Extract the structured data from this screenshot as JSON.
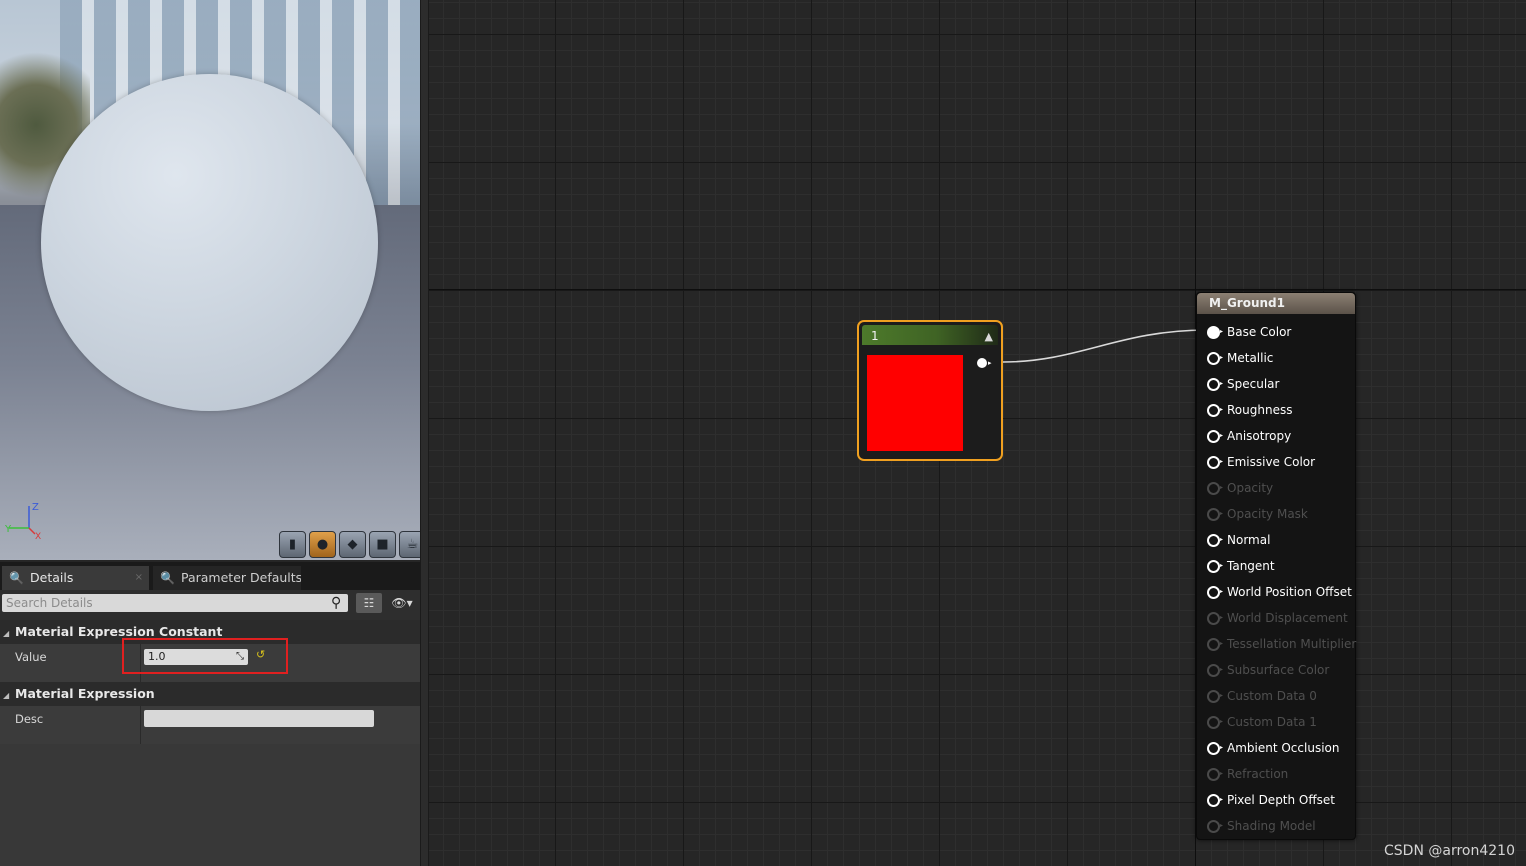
{
  "viewport": {
    "axis_labels": {
      "z": "Z",
      "y": "Y",
      "x": "X"
    },
    "preview_buttons": [
      {
        "icon": "cylinder-icon",
        "glyph": "▮"
      },
      {
        "icon": "sphere-icon",
        "glyph": "●"
      },
      {
        "icon": "plane-icon",
        "glyph": "◆"
      },
      {
        "icon": "cube-icon",
        "glyph": "■"
      },
      {
        "icon": "teapot-icon",
        "glyph": "☕"
      }
    ],
    "active_button": 1
  },
  "details": {
    "tabs": [
      {
        "label": "Details",
        "icon": "details-magnifier-icon",
        "glyph": "🔍"
      },
      {
        "label": "Parameter Defaults",
        "icon": "parameter-magnifier-icon",
        "glyph": "🔍"
      }
    ],
    "close_glyph": "×",
    "search": {
      "placeholder": "Search Details",
      "icon": "search-icon",
      "glyph": "⚲"
    },
    "toolbar": {
      "list_glyph": "☷",
      "eye_glyph": "👁▾"
    },
    "categories": [
      {
        "title": "Material Expression Constant",
        "properties": [
          {
            "label": "Value",
            "value": "1.0"
          }
        ]
      },
      {
        "title": "Material Expression",
        "properties": [
          {
            "label": "Desc",
            "value": ""
          }
        ]
      }
    ],
    "reset_glyph": "↺",
    "drag_glyph": "⤡",
    "collapse_glyph": "◢"
  },
  "graph": {
    "constant_node": {
      "title": "1",
      "color": "#ff0000",
      "collapse_glyph": "▲"
    },
    "material_node": {
      "title": "M_Ground1",
      "inputs": [
        {
          "label": "Base Color",
          "state": "connected"
        },
        {
          "label": "Metallic",
          "state": "enabled"
        },
        {
          "label": "Specular",
          "state": "enabled"
        },
        {
          "label": "Roughness",
          "state": "enabled"
        },
        {
          "label": "Anisotropy",
          "state": "enabled"
        },
        {
          "label": "Emissive Color",
          "state": "enabled"
        },
        {
          "label": "Opacity",
          "state": "disabled"
        },
        {
          "label": "Opacity Mask",
          "state": "disabled"
        },
        {
          "label": "Normal",
          "state": "enabled"
        },
        {
          "label": "Tangent",
          "state": "enabled"
        },
        {
          "label": "World Position Offset",
          "state": "enabled"
        },
        {
          "label": "World Displacement",
          "state": "disabled"
        },
        {
          "label": "Tessellation Multiplier",
          "state": "disabled"
        },
        {
          "label": "Subsurface Color",
          "state": "disabled"
        },
        {
          "label": "Custom Data 0",
          "state": "disabled"
        },
        {
          "label": "Custom Data 1",
          "state": "disabled"
        },
        {
          "label": "Ambient Occlusion",
          "state": "enabled"
        },
        {
          "label": "Refraction",
          "state": "disabled"
        },
        {
          "label": "Pixel Depth Offset",
          "state": "enabled"
        },
        {
          "label": "Shading Model",
          "state": "disabled"
        }
      ]
    }
  },
  "watermark": "CSDN @arron4210",
  "colors": {
    "node_selected_border": "#f0a020",
    "highlight": "#e02020",
    "constant_header": "#4d7a2b"
  }
}
